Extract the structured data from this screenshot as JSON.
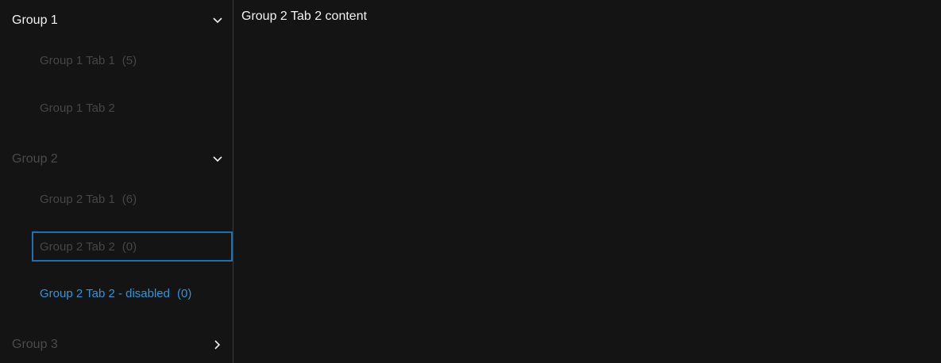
{
  "groups": [
    {
      "label": "Group 1",
      "tabs": [
        {
          "label": "Group 1 Tab 1",
          "count": "(5)"
        },
        {
          "label": "Group 1 Tab 2",
          "count": ""
        }
      ]
    },
    {
      "label": "Group 2",
      "tabs": [
        {
          "label": "Group 2 Tab 1",
          "count": "(6)"
        },
        {
          "label": "Group 2 Tab 2",
          "count": "(0)"
        },
        {
          "label": "Group 2 Tab 2 - disabled",
          "count": "(0)"
        }
      ]
    },
    {
      "label": "Group 3",
      "tabs": []
    }
  ],
  "content": {
    "text": "Group 2 Tab 2 content"
  },
  "colors": {
    "background": "#141414",
    "active_text": "#f0f0f0",
    "muted_text": "#464646",
    "selected_tab": "#2a97d8",
    "focus_border": "#1f6fb5",
    "divider": "#3c3c3c"
  },
  "icons": {
    "expanded": "chevron-down-icon",
    "collapsed": "chevron-right-icon"
  }
}
